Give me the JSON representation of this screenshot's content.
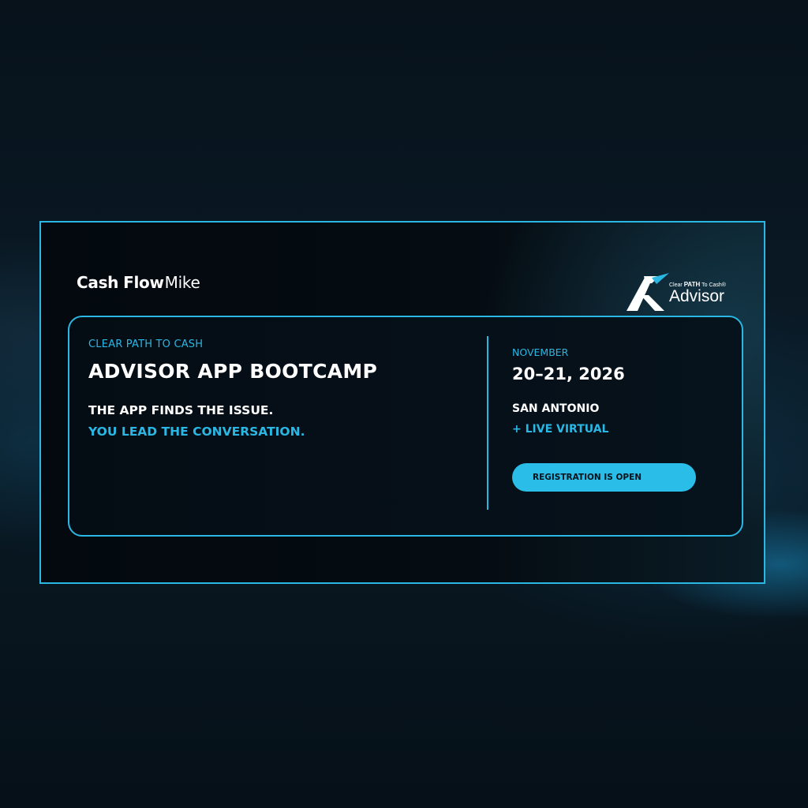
{
  "brand_left": {
    "part1": "Cash",
    "part2": "Flow",
    "part3": "Mike"
  },
  "brand_right": {
    "tag_prefix": "Clear",
    "tag_path": "PATH",
    "tag_suffix": "To Cash®",
    "word": "Advisor",
    "icon": "advisor-a-logo-icon"
  },
  "event": {
    "eyebrow": "CLEAR PATH TO CASH",
    "title": "ADVISOR APP BOOTCAMP",
    "line1": "THE APP FINDS THE ISSUE.",
    "line2": "YOU LEAD THE CONVERSATION.",
    "month": "NOVEMBER",
    "dates": "20–21, 2026",
    "city": "SAN ANTONIO",
    "virtual": "+ LIVE VIRTUAL",
    "cta": "REGISTRATION IS OPEN"
  },
  "colors": {
    "accent": "#2ab7e4",
    "background": "#07131d",
    "text": "#ffffff",
    "button": "#29bde8"
  }
}
